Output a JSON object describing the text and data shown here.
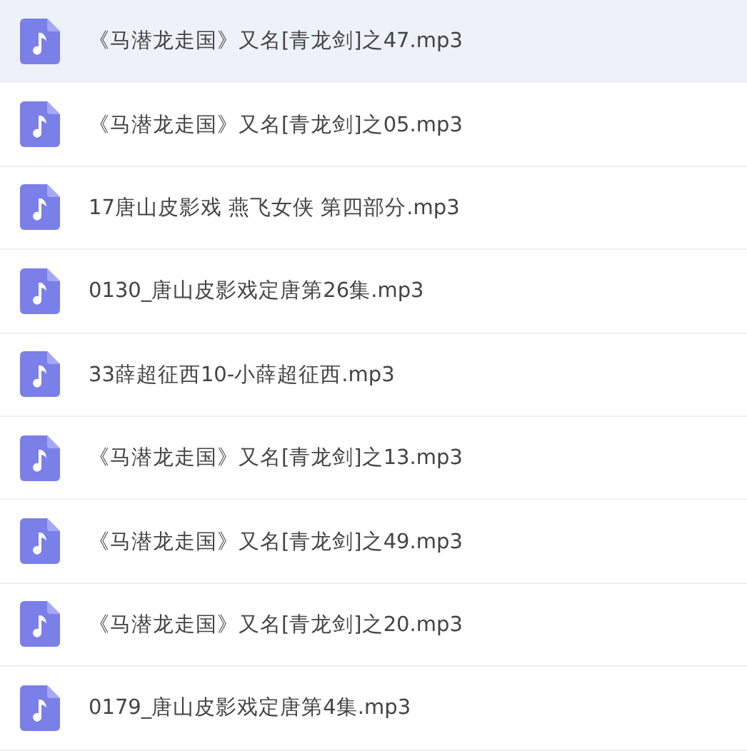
{
  "files": [
    {
      "name": "《马潜龙走国》又名[青龙剑]之47.mp3",
      "selected": true
    },
    {
      "name": "《马潜龙走国》又名[青龙剑]之05.mp3",
      "selected": false
    },
    {
      "name": "17唐山皮影戏 燕飞女侠 第四部分.mp3",
      "selected": false
    },
    {
      "name": "0130_唐山皮影戏定唐第26集.mp3",
      "selected": false
    },
    {
      "name": "33薛超征西10-小薛超征西.mp3",
      "selected": false
    },
    {
      "name": "《马潜龙走国》又名[青龙剑]之13.mp3",
      "selected": false
    },
    {
      "name": "《马潜龙走国》又名[青龙剑]之49.mp3",
      "selected": false
    },
    {
      "name": "《马潜龙走国》又名[青龙剑]之20.mp3",
      "selected": false
    },
    {
      "name": "0179_唐山皮影戏定唐第4集.mp3",
      "selected": false
    }
  ]
}
